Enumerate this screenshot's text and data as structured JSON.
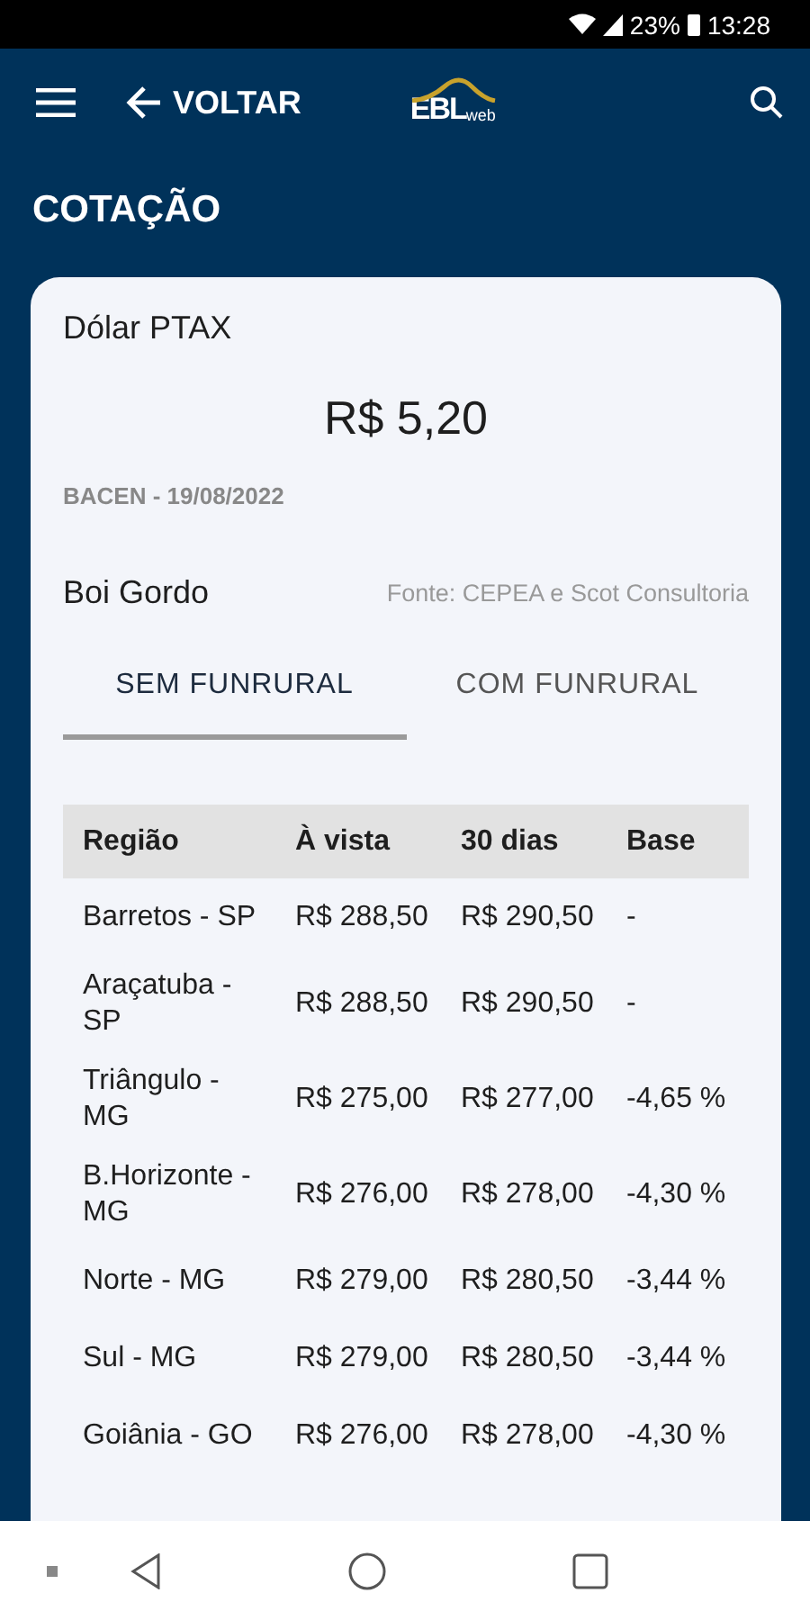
{
  "status_bar": {
    "battery": "23%",
    "time": "13:28"
  },
  "app_bar": {
    "back_label": "VOLTAR",
    "logo": {
      "main": "EBL",
      "sub": "web"
    }
  },
  "page_title": "COTAÇÃO",
  "dollar": {
    "title": "Dólar PTAX",
    "value": "R$ 5,20",
    "source": "BACEN - 19/08/2022"
  },
  "cattle": {
    "title": "Boi Gordo",
    "source": "Fonte: CEPEA e Scot Consultoria"
  },
  "tabs": [
    {
      "label": "SEM FUNRURAL",
      "selected": true
    },
    {
      "label": "COM FUNRURAL",
      "selected": false
    }
  ],
  "table": {
    "columns": [
      "Região",
      "À vista",
      "30 dias",
      "Base"
    ],
    "rows": [
      [
        "Barretos - SP",
        "R$ 288,50",
        "R$ 290,50",
        "-"
      ],
      [
        "Araçatuba - SP",
        "R$ 288,50",
        "R$ 290,50",
        "-"
      ],
      [
        "Triângulo - MG",
        "R$ 275,00",
        "R$ 277,00",
        "-4,65 %"
      ],
      [
        "B.Horizonte - MG",
        "R$ 276,00",
        "R$ 278,00",
        "-4,30 %"
      ],
      [
        "Norte - MG",
        "R$ 279,00",
        "R$ 280,50",
        "-3,44 %"
      ],
      [
        "Sul - MG",
        "R$ 279,00",
        "R$ 280,50",
        "-3,44 %"
      ],
      [
        "Goiânia - GO",
        "R$ 276,00",
        "R$ 278,00",
        "-4,30 %"
      ]
    ]
  }
}
